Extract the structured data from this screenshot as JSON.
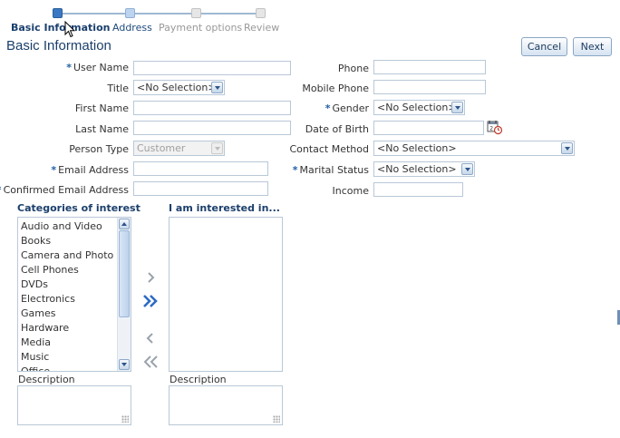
{
  "train": {
    "steps": [
      {
        "label": "Basic Information",
        "state": "active"
      },
      {
        "label": "Address",
        "state": "visited"
      },
      {
        "label": "Payment options",
        "state": "unvisited"
      },
      {
        "label": "Review",
        "state": "unvisited"
      }
    ]
  },
  "page": {
    "title": "Basic Information"
  },
  "buttons": {
    "cancel": "Cancel",
    "next": "Next"
  },
  "required_marker": "*",
  "form": {
    "user_name": {
      "label": "User Name",
      "value": ""
    },
    "title": {
      "label": "Title",
      "value": "<No Selection>"
    },
    "first_name": {
      "label": "First Name",
      "value": ""
    },
    "last_name": {
      "label": "Last Name",
      "value": ""
    },
    "person_type": {
      "label": "Person Type",
      "value": "Customer"
    },
    "email": {
      "label": "Email Address",
      "value": ""
    },
    "confirm_email": {
      "label": "Confirmed Email Address",
      "value": ""
    },
    "phone": {
      "label": "Phone",
      "value": ""
    },
    "mobile": {
      "label": "Mobile Phone",
      "value": ""
    },
    "gender": {
      "label": "Gender",
      "value": "<No Selection>"
    },
    "dob": {
      "label": "Date of Birth",
      "value": ""
    },
    "contact_method": {
      "label": "Contact Method",
      "value": "<No Selection>"
    },
    "marital_status": {
      "label": "Marital Status",
      "value": "<No Selection>"
    },
    "income": {
      "label": "Income",
      "value": ""
    }
  },
  "shuttle": {
    "available_header": "Categories of interest",
    "selected_header": "I am interested in...",
    "available_items": [
      "Audio and Video",
      "Books",
      "Camera and Photo",
      "Cell Phones",
      "DVDs",
      "Electronics",
      "Games",
      "Hardware",
      "Media",
      "Music",
      "Office"
    ],
    "selected_items": [],
    "description_label": "Description",
    "description_label_right": "Description"
  },
  "icons": {
    "calendar": "calendar-icon",
    "move": "chevron-right-icon",
    "move_all": "double-chevron-right-icon",
    "remove": "chevron-left-icon",
    "remove_all": "double-chevron-left-icon",
    "cursor": "mouse-pointer-icon"
  },
  "colors": {
    "accent": "#1b3f6b",
    "required": "#215fa5",
    "train_active": "#3a78c3"
  }
}
